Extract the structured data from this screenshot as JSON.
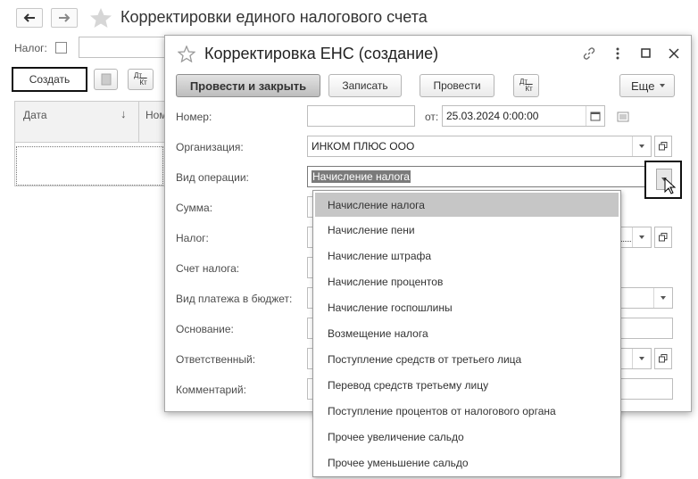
{
  "main": {
    "title": "Корректировки единого налогового счета",
    "filter_label": "Налог:",
    "create_label": "Создать",
    "dtkt_label_top": "Дт",
    "dtkt_label_bottom": "Кт",
    "columns": [
      "Дата",
      "Ном"
    ]
  },
  "dialog": {
    "title": "Корректировка ЕНС (создание)",
    "toolbar": {
      "post_close": "Провести и закрыть",
      "save": "Записать",
      "post": "Провести",
      "more": "Еще"
    },
    "fields": {
      "number_label": "Номер:",
      "number_value": "",
      "date_from_label": "от:",
      "date_value": "25.03.2024  0:00:00",
      "org_label": "Организация:",
      "org_value": "ИНКОМ ПЛЮС ООО",
      "op_label": "Вид операции:",
      "op_value": "Начисление налога",
      "sum_label": "Сумма:",
      "tax_label": "Налог:",
      "account_label": "Счет налога:",
      "payment_type_label": "Вид платежа в бюджет:",
      "basis_label": "Основание:",
      "responsible_label": "Ответственный:",
      "comment_label": "Комментарий:"
    }
  },
  "dropdown": {
    "items": [
      "Начисление налога",
      "Начисление пени",
      "Начисление штрафа",
      "Начисление процентов",
      "Начисление госпошлины",
      "Возмещение налога",
      "Поступление средств от третьего лица",
      "Перевод средств третьему лицу",
      "Поступление процентов от налогового органа",
      "Прочее увеличение сальдо",
      "Прочее уменьшение сальдо"
    ],
    "selected_index": 0
  }
}
